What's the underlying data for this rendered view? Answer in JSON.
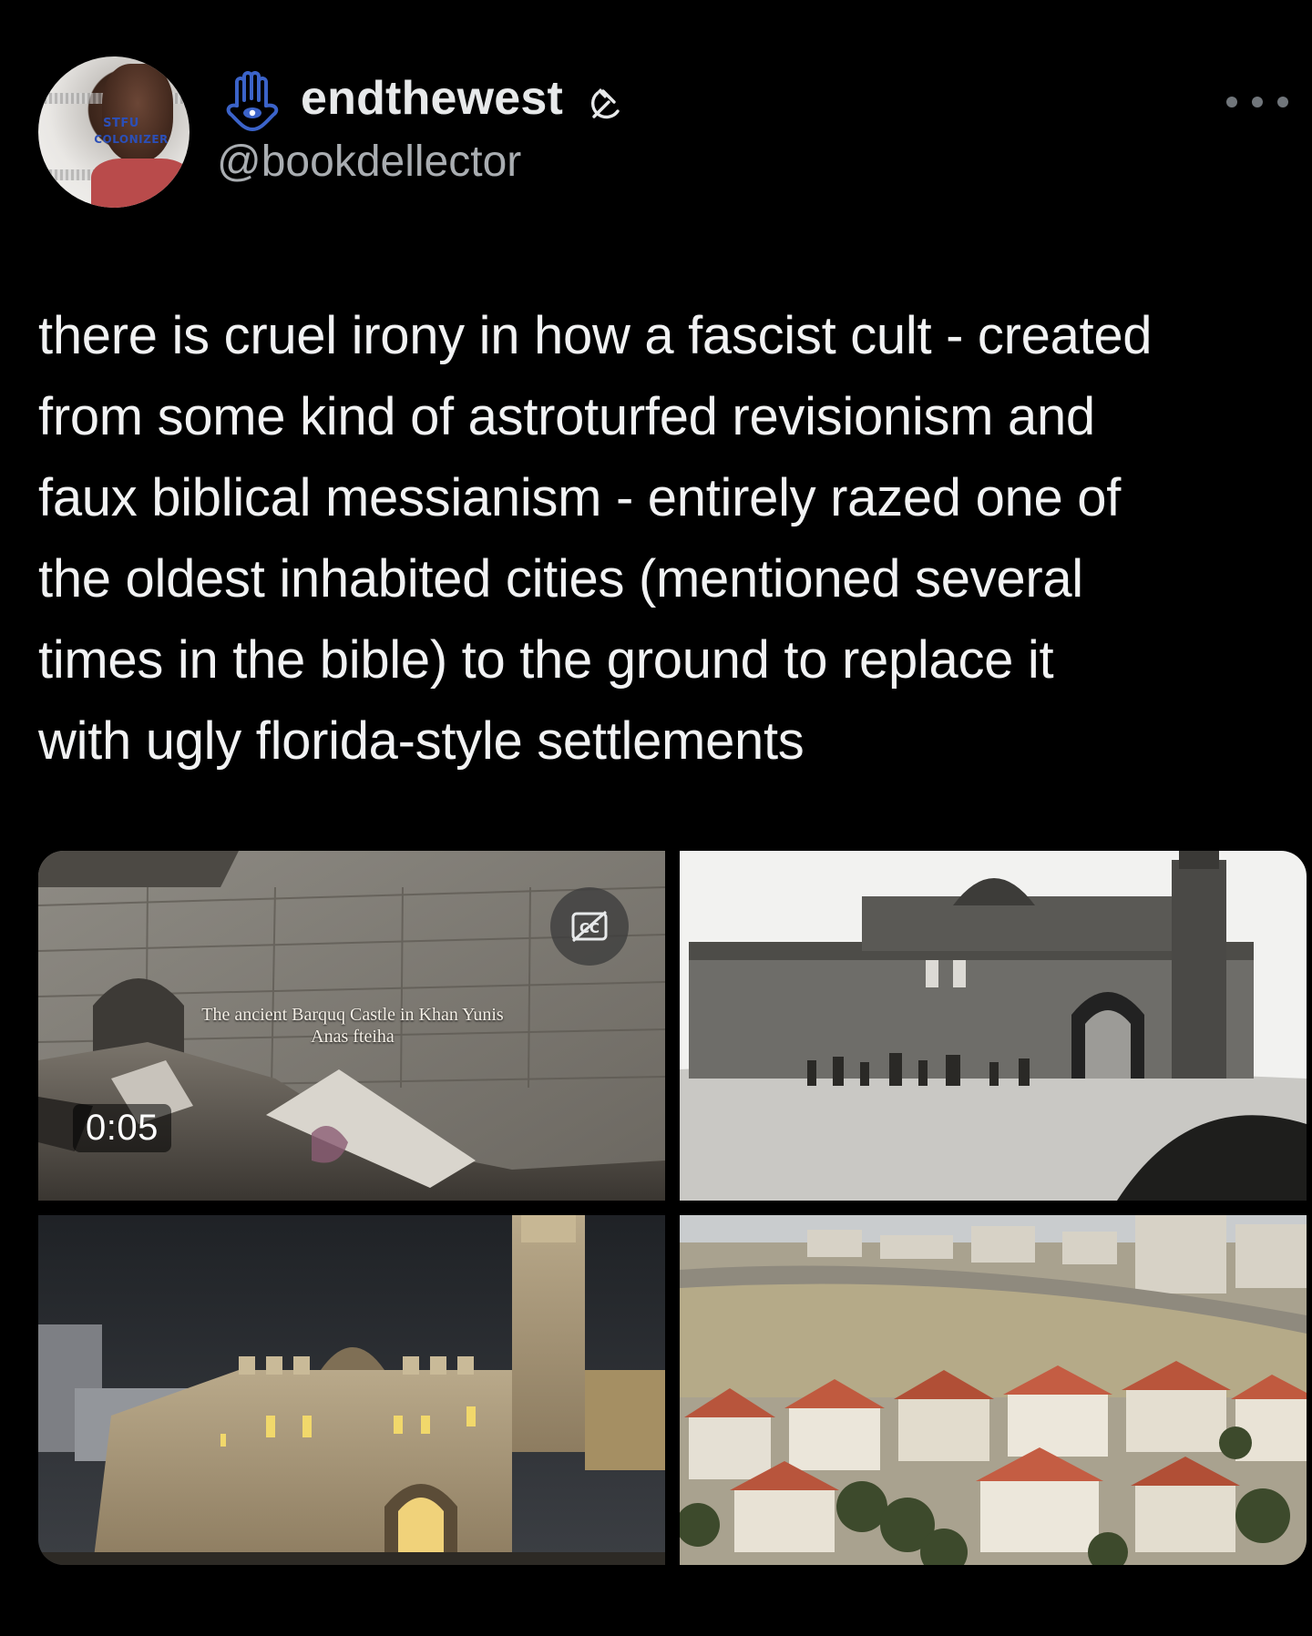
{
  "author": {
    "display_name": "endthewest",
    "handle": "@bookdellector",
    "avatar_stamp_line1": "STFU",
    "avatar_stamp_line2": "COLONIZER"
  },
  "icons": {
    "name_prefix": "hamsa-icon",
    "name_suffix": "hammer-and-sickle-icon",
    "more": "more-options-icon",
    "captions": "closed-captions-icon"
  },
  "tweet": {
    "text": "there is cruel irony in how a fascist cult - created\nfrom some kind of astroturfed revisionism and\nfaux biblical messianism - entirely razed one of\nthe oldest inhabited cities (mentioned several\ntimes in the bible) to the ground to replace it\nwith ugly florida-style settlements"
  },
  "media": {
    "video": {
      "caption_line1": "The ancient Barquq Castle in Khan Yunis",
      "caption_line2": "Anas fteiha",
      "duration": "0:05"
    },
    "photos": [
      {
        "subject": "historic-castle-photo"
      },
      {
        "subject": "castle-at-night-photo"
      },
      {
        "subject": "settlement-houses-photo"
      }
    ]
  },
  "colors": {
    "background": "#000000",
    "text_primary": "#e7e9ea",
    "text_secondary": "#a9adb1",
    "hamsa_blue": "#3b63c9"
  }
}
